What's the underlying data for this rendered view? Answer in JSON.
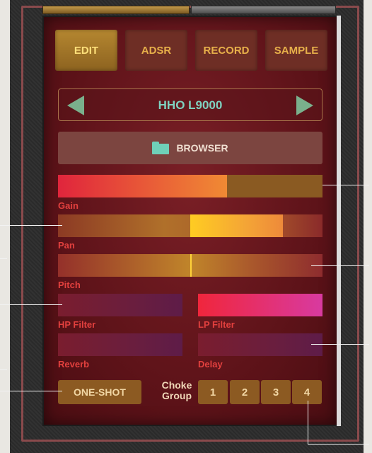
{
  "tabs": [
    {
      "label": "EDIT",
      "active": true
    },
    {
      "label": "ADSR",
      "active": false
    },
    {
      "label": "RECORD",
      "active": false
    },
    {
      "label": "SAMPLE",
      "active": false
    }
  ],
  "preset": {
    "name": "HHO L9000",
    "prev_icon": "triangle-left-icon",
    "next_icon": "triangle-right-icon"
  },
  "browser": {
    "label": "BROWSER",
    "icon": "folder-icon"
  },
  "params": {
    "gain": {
      "label": "Gain",
      "level": 0.64
    },
    "pan": {
      "label": "Pan",
      "center": 0.5,
      "level": 0.85
    },
    "pitch": {
      "label": "Pitch",
      "level": 0.5
    },
    "hp_filter": {
      "label": "HP Filter",
      "level": 0.0
    },
    "lp_filter": {
      "label": "LP Filter",
      "level": 1.0
    },
    "reverb": {
      "label": "Reverb",
      "level": 0.0
    },
    "delay": {
      "label": "Delay",
      "level": 0.0
    }
  },
  "oneshot": {
    "label": "ONE-SHOT"
  },
  "choke": {
    "label": "Choke Group",
    "buttons": [
      "1",
      "2",
      "3",
      "4"
    ]
  },
  "colors": {
    "accent_gold": "#e7b04a",
    "preset_text": "#7fd2c0",
    "label_red": "#e2403e",
    "lp_pink": "#e23a8a"
  }
}
